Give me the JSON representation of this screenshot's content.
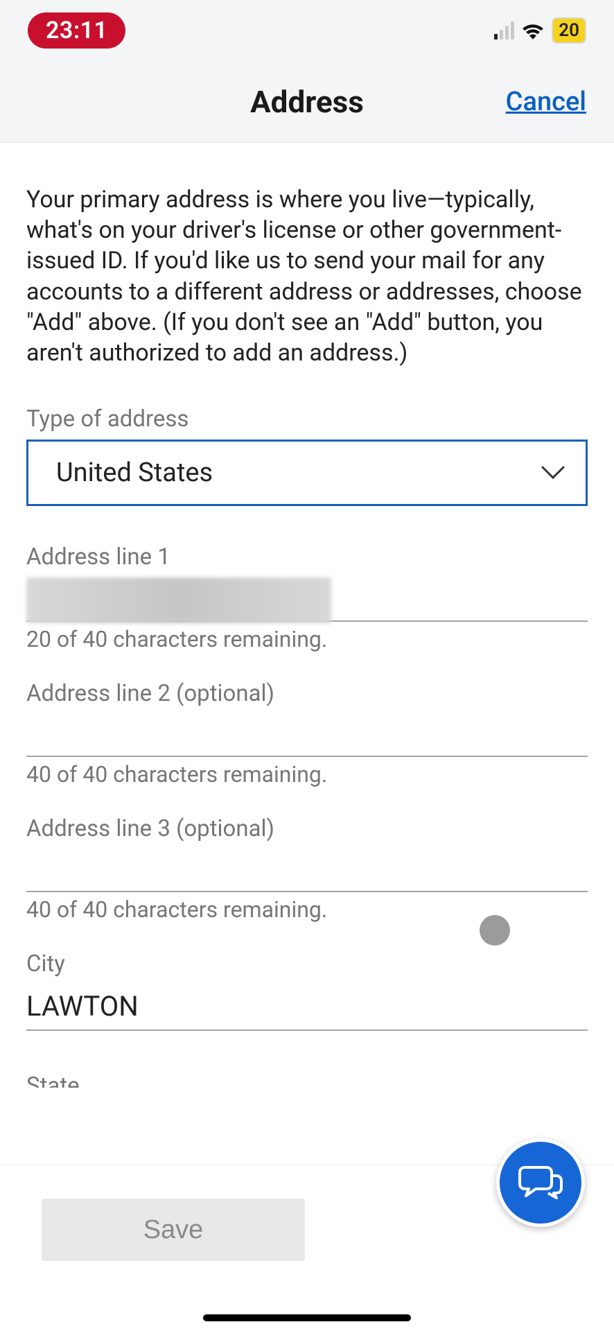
{
  "status": {
    "time": "23:11",
    "battery": "20"
  },
  "header": {
    "title": "Address",
    "cancel": "Cancel"
  },
  "description": "Your primary address is where you live—typically, what's on your driver's license or other government-issued ID. If you'd like us to send your mail for any accounts to a different address or addresses, choose \"Add\" above. (If you don't see an \"Add\" button, you aren't authorized to add an address.)",
  "fields": {
    "type": {
      "label": "Type of address",
      "value": "United States"
    },
    "line1": {
      "label": "Address line 1",
      "helper": "20 of 40 characters remaining."
    },
    "line2": {
      "label": "Address line 2 (optional)",
      "helper": "40 of 40 characters remaining."
    },
    "line3": {
      "label": "Address line 3 (optional)",
      "helper": "40 of 40 characters remaining."
    },
    "city": {
      "label": "City",
      "value": "LAWTON"
    },
    "state": {
      "label": "State"
    }
  },
  "footer": {
    "save": "Save"
  }
}
